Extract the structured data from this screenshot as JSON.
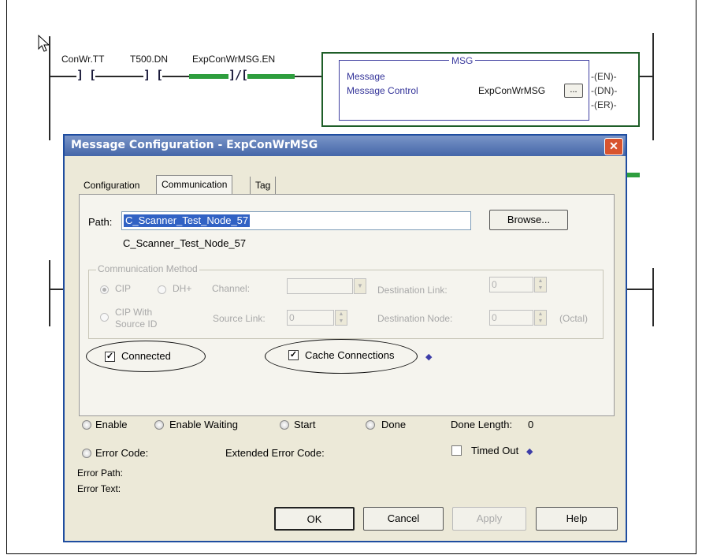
{
  "ladder": {
    "contacts": [
      "ConWr.TT",
      "T500.DN",
      "ExpConWrMSG.EN"
    ],
    "msg_block": {
      "title": "MSG",
      "row1_label": "Message",
      "row2_label": "Message Control",
      "control_value": "ExpConWrMSG",
      "browse_glyph": "...",
      "coils": [
        "EN",
        "DN",
        "ER"
      ]
    }
  },
  "dialog": {
    "title": "Message Configuration - ExpConWrMSG",
    "close_glyph": "✕",
    "tabs": [
      {
        "label": "Configuration",
        "active": false
      },
      {
        "label": "Communication",
        "active": true
      },
      {
        "label": "Tag",
        "active": false
      }
    ],
    "path": {
      "label": "Path:",
      "value": "C_Scanner_Test_Node_57",
      "resolved": "C_Scanner_Test_Node_57",
      "browse_label": "Browse..."
    },
    "comm_method": {
      "group_label": "Communication Method",
      "cip_label": "CIP",
      "dhplus_label": "DH+",
      "channel_label": "Channel:",
      "dest_link_label": "Destination Link:",
      "dest_link_value": "0",
      "cip_with_line1": "CIP With",
      "cip_with_line2": "Source ID",
      "source_link_label": "Source Link:",
      "source_link_value": "0",
      "dest_node_label": "Destination Node:",
      "dest_node_value": "0",
      "octal_label": "(Octal)"
    },
    "connected": {
      "label": "Connected",
      "checked": true
    },
    "cache_connections": {
      "label": "Cache Connections",
      "checked": true
    },
    "status": {
      "enable": "Enable",
      "enable_waiting": "Enable Waiting",
      "start": "Start",
      "done": "Done",
      "done_length_label": "Done Length:",
      "done_length_value": "0",
      "error_code": "Error Code:",
      "extended_error_code": "Extended Error Code:",
      "timed_out": "Timed Out",
      "error_path": "Error Path:",
      "error_text": "Error Text:"
    },
    "buttons": {
      "ok": "OK",
      "cancel": "Cancel",
      "apply": "Apply",
      "help": "Help"
    },
    "colors": {
      "titlebar": "#4466a8",
      "close": "#d8542e",
      "selection": "#3162c4",
      "arrow": "#3d3da8",
      "rung_highlight": "#2e9e3e"
    }
  }
}
